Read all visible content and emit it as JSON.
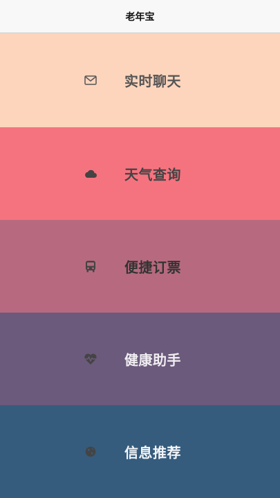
{
  "header": {
    "title": "老年宝"
  },
  "menu": {
    "items": [
      {
        "label": "实时聊天",
        "icon": "envelope-icon",
        "bg": "#fdd5bd",
        "text_color": "#555555",
        "icon_color": "#555555"
      },
      {
        "label": "天气查询",
        "icon": "cloud-icon",
        "bg": "#f5737f",
        "text_color": "#444444",
        "icon_color": "#444444"
      },
      {
        "label": "便捷订票",
        "icon": "bus-icon",
        "bg": "#b76a7f",
        "text_color": "#333333",
        "icon_color": "#444444"
      },
      {
        "label": "健康助手",
        "icon": "heartbeat-icon",
        "bg": "#6b5a7b",
        "text_color": "#f0eef2",
        "icon_color": "#444444"
      },
      {
        "label": "信息推荐",
        "icon": "globe-icon",
        "bg": "#355c7d",
        "text_color": "#f3f5f8",
        "icon_color": "#444444"
      }
    ]
  }
}
